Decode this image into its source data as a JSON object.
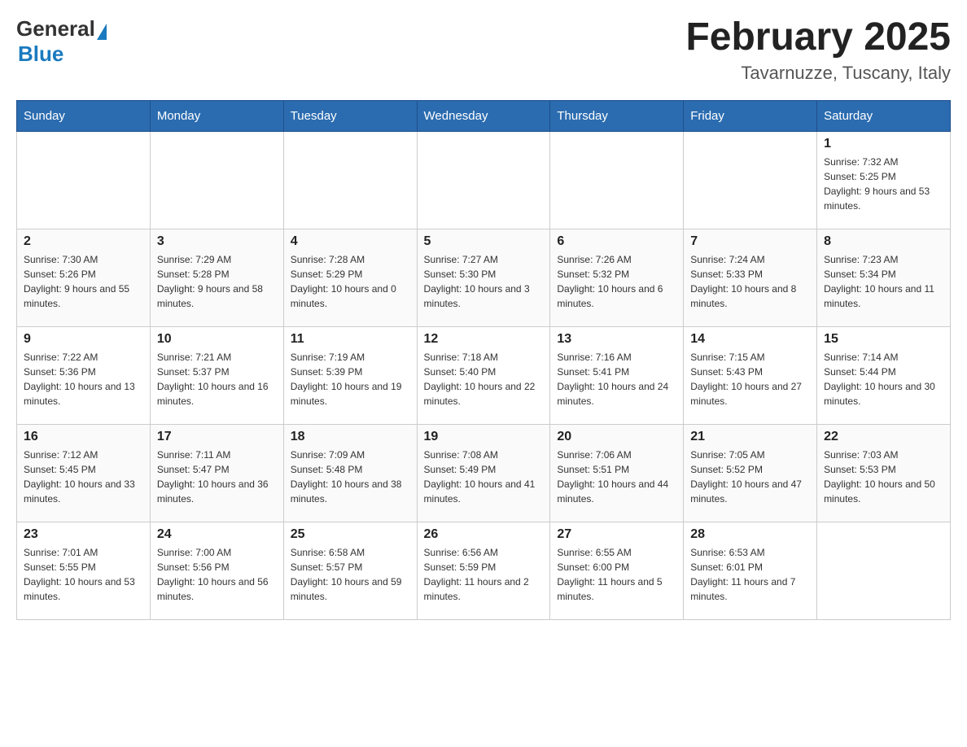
{
  "header": {
    "logo_text_general": "General",
    "logo_text_blue": "Blue",
    "title": "February 2025",
    "subtitle": "Tavarnuzze, Tuscany, Italy"
  },
  "days_of_week": [
    "Sunday",
    "Monday",
    "Tuesday",
    "Wednesday",
    "Thursday",
    "Friday",
    "Saturday"
  ],
  "weeks": [
    [
      {
        "day": "",
        "info": ""
      },
      {
        "day": "",
        "info": ""
      },
      {
        "day": "",
        "info": ""
      },
      {
        "day": "",
        "info": ""
      },
      {
        "day": "",
        "info": ""
      },
      {
        "day": "",
        "info": ""
      },
      {
        "day": "1",
        "info": "Sunrise: 7:32 AM\nSunset: 5:25 PM\nDaylight: 9 hours and 53 minutes."
      }
    ],
    [
      {
        "day": "2",
        "info": "Sunrise: 7:30 AM\nSunset: 5:26 PM\nDaylight: 9 hours and 55 minutes."
      },
      {
        "day": "3",
        "info": "Sunrise: 7:29 AM\nSunset: 5:28 PM\nDaylight: 9 hours and 58 minutes."
      },
      {
        "day": "4",
        "info": "Sunrise: 7:28 AM\nSunset: 5:29 PM\nDaylight: 10 hours and 0 minutes."
      },
      {
        "day": "5",
        "info": "Sunrise: 7:27 AM\nSunset: 5:30 PM\nDaylight: 10 hours and 3 minutes."
      },
      {
        "day": "6",
        "info": "Sunrise: 7:26 AM\nSunset: 5:32 PM\nDaylight: 10 hours and 6 minutes."
      },
      {
        "day": "7",
        "info": "Sunrise: 7:24 AM\nSunset: 5:33 PM\nDaylight: 10 hours and 8 minutes."
      },
      {
        "day": "8",
        "info": "Sunrise: 7:23 AM\nSunset: 5:34 PM\nDaylight: 10 hours and 11 minutes."
      }
    ],
    [
      {
        "day": "9",
        "info": "Sunrise: 7:22 AM\nSunset: 5:36 PM\nDaylight: 10 hours and 13 minutes."
      },
      {
        "day": "10",
        "info": "Sunrise: 7:21 AM\nSunset: 5:37 PM\nDaylight: 10 hours and 16 minutes."
      },
      {
        "day": "11",
        "info": "Sunrise: 7:19 AM\nSunset: 5:39 PM\nDaylight: 10 hours and 19 minutes."
      },
      {
        "day": "12",
        "info": "Sunrise: 7:18 AM\nSunset: 5:40 PM\nDaylight: 10 hours and 22 minutes."
      },
      {
        "day": "13",
        "info": "Sunrise: 7:16 AM\nSunset: 5:41 PM\nDaylight: 10 hours and 24 minutes."
      },
      {
        "day": "14",
        "info": "Sunrise: 7:15 AM\nSunset: 5:43 PM\nDaylight: 10 hours and 27 minutes."
      },
      {
        "day": "15",
        "info": "Sunrise: 7:14 AM\nSunset: 5:44 PM\nDaylight: 10 hours and 30 minutes."
      }
    ],
    [
      {
        "day": "16",
        "info": "Sunrise: 7:12 AM\nSunset: 5:45 PM\nDaylight: 10 hours and 33 minutes."
      },
      {
        "day": "17",
        "info": "Sunrise: 7:11 AM\nSunset: 5:47 PM\nDaylight: 10 hours and 36 minutes."
      },
      {
        "day": "18",
        "info": "Sunrise: 7:09 AM\nSunset: 5:48 PM\nDaylight: 10 hours and 38 minutes."
      },
      {
        "day": "19",
        "info": "Sunrise: 7:08 AM\nSunset: 5:49 PM\nDaylight: 10 hours and 41 minutes."
      },
      {
        "day": "20",
        "info": "Sunrise: 7:06 AM\nSunset: 5:51 PM\nDaylight: 10 hours and 44 minutes."
      },
      {
        "day": "21",
        "info": "Sunrise: 7:05 AM\nSunset: 5:52 PM\nDaylight: 10 hours and 47 minutes."
      },
      {
        "day": "22",
        "info": "Sunrise: 7:03 AM\nSunset: 5:53 PM\nDaylight: 10 hours and 50 minutes."
      }
    ],
    [
      {
        "day": "23",
        "info": "Sunrise: 7:01 AM\nSunset: 5:55 PM\nDaylight: 10 hours and 53 minutes."
      },
      {
        "day": "24",
        "info": "Sunrise: 7:00 AM\nSunset: 5:56 PM\nDaylight: 10 hours and 56 minutes."
      },
      {
        "day": "25",
        "info": "Sunrise: 6:58 AM\nSunset: 5:57 PM\nDaylight: 10 hours and 59 minutes."
      },
      {
        "day": "26",
        "info": "Sunrise: 6:56 AM\nSunset: 5:59 PM\nDaylight: 11 hours and 2 minutes."
      },
      {
        "day": "27",
        "info": "Sunrise: 6:55 AM\nSunset: 6:00 PM\nDaylight: 11 hours and 5 minutes."
      },
      {
        "day": "28",
        "info": "Sunrise: 6:53 AM\nSunset: 6:01 PM\nDaylight: 11 hours and 7 minutes."
      },
      {
        "day": "",
        "info": ""
      }
    ]
  ]
}
